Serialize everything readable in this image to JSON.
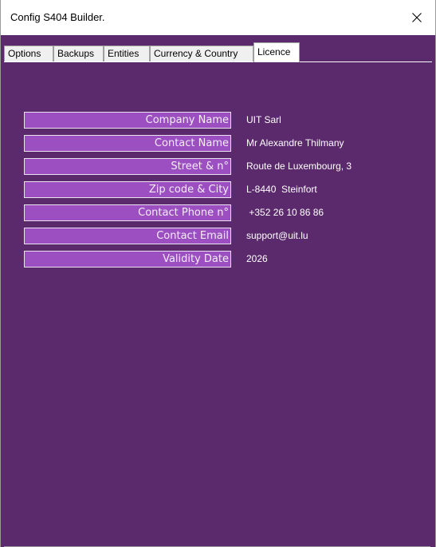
{
  "window": {
    "title": "Config S404 Builder."
  },
  "tabs": [
    {
      "label": "Options"
    },
    {
      "label": "Backups"
    },
    {
      "label": "Entities"
    },
    {
      "label": "Currency & Country"
    },
    {
      "label": "Licence",
      "active": true
    }
  ],
  "licence": {
    "fields": [
      {
        "label": "Company Name",
        "value": "UIT Sarl"
      },
      {
        "label": "Contact Name",
        "value": "Mr Alexandre Thilmany"
      },
      {
        "label": "Street & n°",
        "value": "Route de Luxembourg, 3"
      },
      {
        "label": "Zip code & City",
        "value": "L-8440  Steinfort"
      },
      {
        "label": "Contact Phone n°",
        "value": " +352 26 10 86 86"
      },
      {
        "label": "Contact Email",
        "value": "support@uit.lu"
      },
      {
        "label": "Validity Date",
        "value": "2026"
      }
    ]
  },
  "icons": {
    "close": "close-icon"
  },
  "colors": {
    "panel_background": "#5b2a6c",
    "label_background": "#9b4fc0",
    "label_border": "#ece2f2",
    "value_text": "#ffffff"
  }
}
